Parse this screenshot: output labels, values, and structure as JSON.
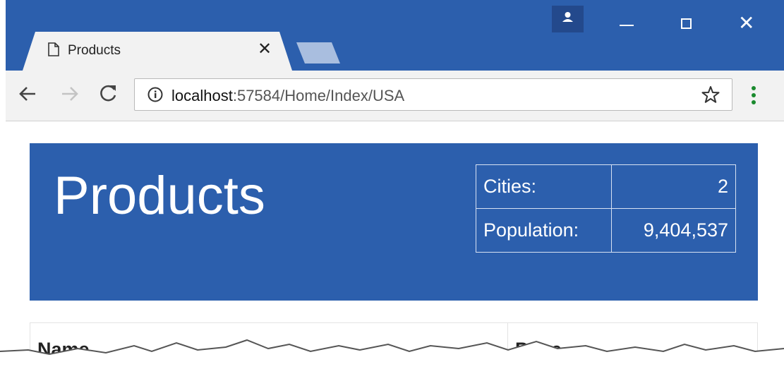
{
  "browser": {
    "tab_title": "Products",
    "url_host": "localhost",
    "url_rest": ":57584/Home/Index/USA",
    "icons": {
      "tab": "page-icon",
      "close": "close-icon",
      "profile": "profile-icon",
      "back": "back-arrow-icon",
      "forward": "forward-arrow-icon",
      "reload": "reload-icon",
      "info": "info-icon",
      "bookmark": "star-icon",
      "menu": "kebab-menu-icon"
    },
    "colors": {
      "titlebar": "#2c5fad",
      "toolbar": "#f2f2f2"
    }
  },
  "page": {
    "header": {
      "title": "Products",
      "stats": [
        {
          "label": "Cities:",
          "value": "2"
        },
        {
          "label": "Population:",
          "value": "9,404,537"
        }
      ],
      "color": "#2c5fad"
    },
    "table": {
      "columns": [
        "Name",
        "Price"
      ]
    }
  }
}
